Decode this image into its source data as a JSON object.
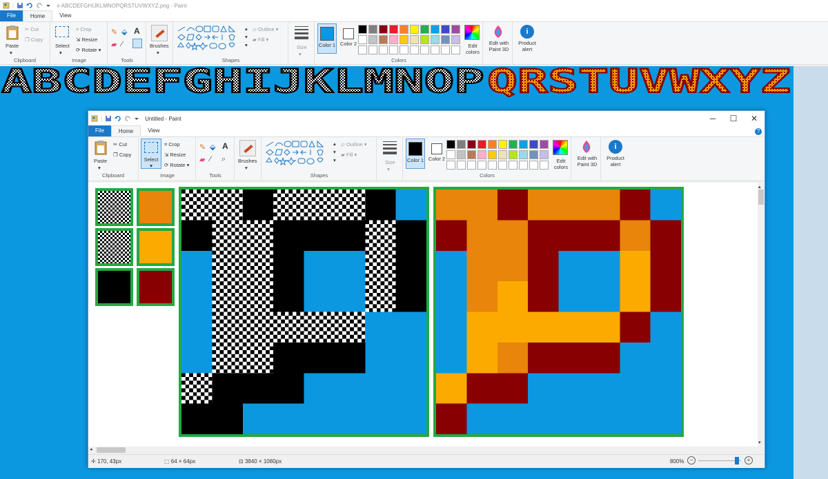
{
  "outer": {
    "title": "x-ABCDEFGHIJKLMNOPQRSTUVWXYZ.png - Paint",
    "tabs": [
      "File",
      "Home",
      "View"
    ],
    "ribbon": {
      "clipboard": {
        "paste": "Paste",
        "cut": "Cut",
        "copy": "Copy",
        "label": "Clipboard"
      },
      "image": {
        "select": "Select",
        "crop": "Crop",
        "resize": "Resize",
        "rotate": "Rotate",
        "label": "Image"
      },
      "tools": {
        "label": "Tools"
      },
      "brushes": "Brushes",
      "shapes": {
        "outline": "Outline",
        "fill": "Fill",
        "label": "Shapes"
      },
      "size": "Size",
      "color1": "Color 1",
      "color2": "Color 2",
      "colors_label": "Colors",
      "edit_colors": "Edit colors",
      "paint3d": "Edit with Paint 3D",
      "product_alert": "Product alert"
    },
    "banner_text": "ABCDEFGHIJKLMNOPQRSTUVWXYZ"
  },
  "inner": {
    "title": "Untitled - Paint",
    "tabs": [
      "File",
      "Home",
      "View"
    ],
    "ribbon": {
      "clipboard": {
        "paste": "Paste",
        "cut": "Cut",
        "copy": "Copy",
        "label": "Clipboard"
      },
      "image": {
        "select": "Select",
        "crop": "Crop",
        "resize": "Resize",
        "rotate": "Rotate",
        "label": "Image"
      },
      "tools": {
        "label": "Tools"
      },
      "brushes": "Brushes",
      "shapes": {
        "outline": "Outline",
        "fill": "Fill",
        "label": "Shapes"
      },
      "size": "Size",
      "color1": "Color 1",
      "color2": "Color 2",
      "colors_label": "Colors",
      "edit_colors": "Edit colors",
      "paint3d": "Edit with Paint 3D",
      "product_alert": "Product alert"
    },
    "status": {
      "cursor": "170, 43px",
      "selection": "64 × 64px",
      "image_size": "3840 × 1080px",
      "zoom": "800%"
    }
  },
  "palette": [
    "#000000",
    "#7f7f7f",
    "#880015",
    "#ed1c24",
    "#ff7f27",
    "#fff200",
    "#22b14c",
    "#00a2e8",
    "#3f48cc",
    "#a349a4",
    "#ffffff",
    "#c3c3c3",
    "#b97a57",
    "#ffaec9",
    "#ffc90e",
    "#efe4b0",
    "#b5e61d",
    "#99d9ea",
    "#7092be",
    "#c8bfe7"
  ],
  "colors": {
    "accent": "#1979ca",
    "canvas_bg": "#0c98e0",
    "tile_border": "#25a843",
    "orange": "#e8850a",
    "yellow": "#fcaa00",
    "maroon": "#880000"
  }
}
